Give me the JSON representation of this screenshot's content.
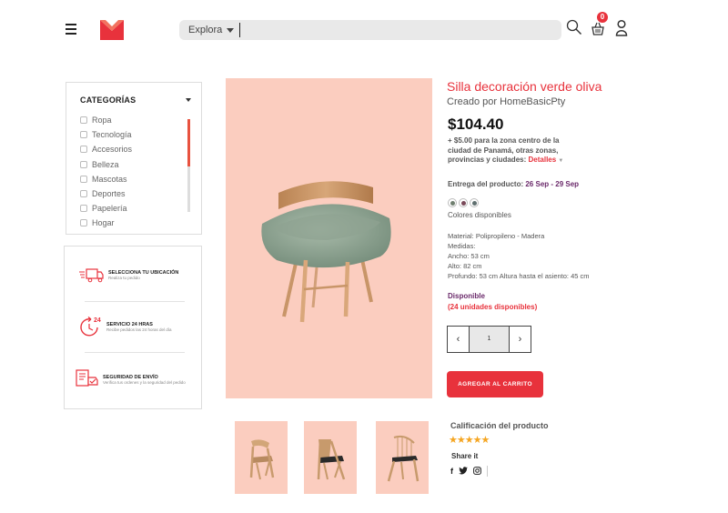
{
  "header": {
    "search_dropdown_label": "Explora",
    "search_placeholder": "",
    "cart_count": "0"
  },
  "categories": {
    "title": "CATEGORÍAS",
    "items": [
      "Ropa",
      "Tecnología",
      "Accesorios",
      "Belleza",
      "Mascotas",
      "Deportes",
      "Papelería",
      "Hogar"
    ]
  },
  "services": [
    {
      "title": "SELECCIONA TU UBICACIÓN",
      "subtitle": "Realiza tu pedido",
      "icon": "delivery-truck-icon"
    },
    {
      "title": "SERVICIO 24 HRAS",
      "subtitle": "Recibe pedidos las 24 horas del día",
      "icon": "24h-service-icon",
      "badge": "24"
    },
    {
      "title": "SEGURIDAD DE ENVÍO",
      "subtitle": "Verifica tus ordenes y la seguridad del pedido",
      "icon": "secure-shipping-icon"
    }
  ],
  "product": {
    "title": "Silla decoración verde oliva",
    "seller": "Creado por HomeBasicPty",
    "price": "$104.40",
    "shipping_note": "+ $5.00 para la zona centro de la ciudad de Panamá, otras zonas, provincias y ciudades:",
    "details_link": "Detalles",
    "delivery_label": "Entrega del producto:",
    "delivery_dates": "26 Sep - 29 Sep",
    "colors_label": "Colores disponibles",
    "swatch_colors": [
      "#6f7f6f",
      "#7a4a5a",
      "#5f6f6f"
    ],
    "specs": [
      "Material: Polipropileno - Madera",
      "Medidas:",
      "Ancho: 53 cm",
      "Alto: 82 cm",
      "Profundo: 53 cm Altura hasta el asiento: 45 cm"
    ],
    "availability": "Disponible",
    "units_available": "(24 unidades disponibles)",
    "quantity": "1",
    "add_to_cart_label": "AGREGAR AL CARRITO",
    "rating_label": "Calificación del producto",
    "rating_stars": "★★★★★",
    "rating_value": 5,
    "share_label": "Share it"
  },
  "colors": {
    "accent": "#e8323c",
    "product_bg": "#fbcdbf",
    "delivery_date": "#6b2a6b"
  }
}
